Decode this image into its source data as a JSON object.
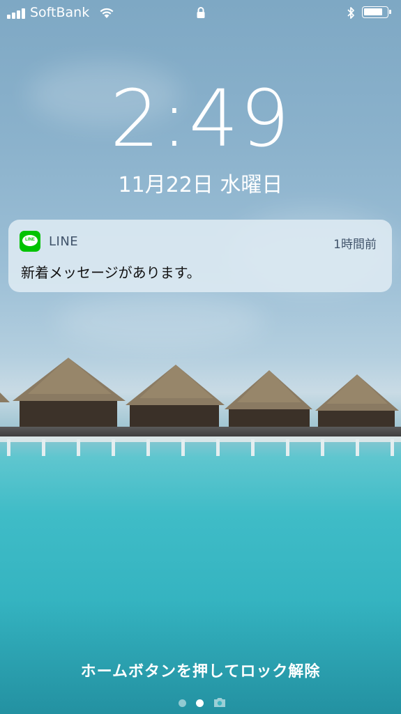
{
  "status_bar": {
    "carrier": "SoftBank",
    "signal_bars": 4,
    "wifi": "wifi-icon",
    "orientation_lock": "lock-icon",
    "bluetooth": "bluetooth-icon",
    "battery_level": 0.85
  },
  "lock_screen": {
    "time": "2:49",
    "date": "11月22日 水曜日"
  },
  "notification": {
    "app_name": "LINE",
    "app_icon": "line-app-icon",
    "app_icon_text": "LINE",
    "time_ago": "1時間前",
    "message": "新着メッセージがあります。"
  },
  "bottom": {
    "unlock_hint": "ホームボタンを押してロック解除",
    "pages": [
      "page-dot",
      "page-dot-current",
      "camera-icon"
    ]
  },
  "colors": {
    "line_green": "#00c300",
    "notification_bg": "#deeaf2",
    "water": "#3fbcc7",
    "sky": "#8bb2cc"
  }
}
